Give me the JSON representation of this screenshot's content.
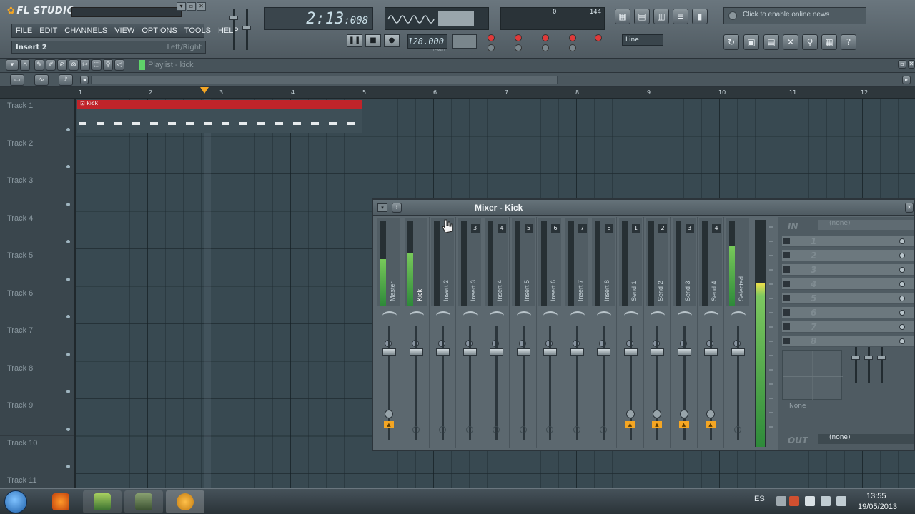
{
  "app": {
    "logo": "FL STUDIO"
  },
  "menu": [
    "FILE",
    "EDIT",
    "CHANNELS",
    "VIEW",
    "OPTIONS",
    "TOOLS",
    "HELP"
  ],
  "hint": {
    "left": "Insert 2",
    "right": "Left/Right"
  },
  "time_display": {
    "main": "2:13",
    "sub": ":008"
  },
  "cpu": {
    "value1": "0",
    "value2": "144"
  },
  "transport": {
    "tempo": "128.000",
    "tempo_label": "TEMPO"
  },
  "input_select": "Line",
  "news": "Click to enable online news",
  "playlist": {
    "title": "Playlist - kick",
    "ruler": [
      "1",
      "2",
      "3",
      "4",
      "5",
      "6",
      "7",
      "8",
      "9",
      "10",
      "11",
      "12"
    ],
    "tracks": [
      "Track 1",
      "Track 2",
      "Track 3",
      "Track 4",
      "Track 5",
      "Track 6",
      "Track 7",
      "Track 8",
      "Track 9",
      "Track 10",
      "Track 11"
    ],
    "clip_name": "kick"
  },
  "mixer": {
    "title": "Mixer - Kick",
    "strips": [
      {
        "name": "Master",
        "num": "",
        "level": 0.55
      },
      {
        "name": "Kick",
        "num": "",
        "level": 0.62
      },
      {
        "name": "Insert 2",
        "num": "",
        "level": 0
      },
      {
        "name": "Insert 3",
        "num": "3",
        "level": 0
      },
      {
        "name": "Insert 4",
        "num": "4",
        "level": 0
      },
      {
        "name": "Insert 5",
        "num": "5",
        "level": 0
      },
      {
        "name": "Insert 6",
        "num": "6",
        "level": 0
      },
      {
        "name": "Insert 7",
        "num": "7",
        "level": 0
      },
      {
        "name": "Insert 8",
        "num": "8",
        "level": 0
      },
      {
        "name": "Send 1",
        "num": "1",
        "level": 0
      },
      {
        "name": "Send 2",
        "num": "2",
        "level": 0
      },
      {
        "name": "Send 3",
        "num": "3",
        "level": 0
      },
      {
        "name": "Send 4",
        "num": "4",
        "level": 0
      },
      {
        "name": "Selected",
        "num": "",
        "level": 0.7
      }
    ],
    "in_label": "IN",
    "in_value": "(none)",
    "fx_slots": [
      "1",
      "2",
      "3",
      "4",
      "5",
      "6",
      "7",
      "8"
    ],
    "eq_none": "None",
    "out_label": "OUT",
    "out_value": "(none)"
  },
  "taskbar": {
    "language": "ES",
    "time": "13:55",
    "date": "19/05/2013"
  },
  "colors": {
    "accent": "#f5a623",
    "clip_header": "#c0242a",
    "meter_green": "#2e8a3a"
  }
}
